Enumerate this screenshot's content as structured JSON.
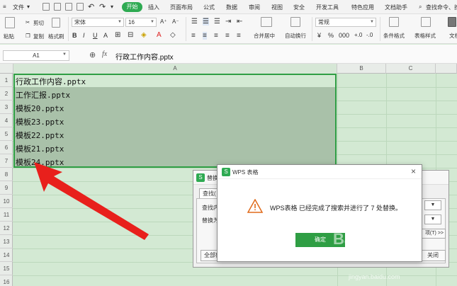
{
  "menubar": {
    "file": "文件",
    "tabs": [
      "开始",
      "插入",
      "页面布局",
      "公式",
      "数据",
      "审阅",
      "视图",
      "安全",
      "开发工具",
      "特色应用",
      "文档助手"
    ],
    "search": "查找命令、搜"
  },
  "ribbon": {
    "paste": "粘贴",
    "cut": "剪切",
    "copy": "复制",
    "format_painter": "格式刷",
    "font_name": "宋体",
    "font_size": "16",
    "number_format": "常规",
    "merge_center": "合并居中",
    "wrap_text": "自动换行",
    "conditional_format": "条件格式",
    "table_style": "表格样式",
    "doc": "文档"
  },
  "formulabar": {
    "cell_ref": "A1",
    "fx": "fx",
    "content": "行政工作内容.pptx"
  },
  "grid": {
    "columns": [
      "A",
      "B",
      "C"
    ],
    "rows": [
      "1",
      "2",
      "3",
      "4",
      "5",
      "6",
      "7",
      "8",
      "9",
      "10",
      "11",
      "12",
      "13",
      "14",
      "15",
      "16"
    ],
    "cells": [
      "行政工作内容.pptx",
      "工作汇报.pptx",
      "模板20.pptx",
      "模板23.pptx",
      "模板22.pptx",
      "模板21.pptx",
      "模板24.pptx"
    ]
  },
  "replace_dialog": {
    "title": "替换",
    "find_tab": "查找(",
    "find_label": "查找内",
    "replace_label": "替换为",
    "options_btn": "项(T) >>",
    "replace_all": "全部替",
    "close_btn": "关闭"
  },
  "wps_dialog": {
    "title": "WPS 表格",
    "message": "WPS表格 已经完成了搜索并进行了 7 处替换。",
    "ok": "确定"
  },
  "watermark": {
    "brand": "Baidu经验",
    "url": "jingyan.baidu.com"
  }
}
